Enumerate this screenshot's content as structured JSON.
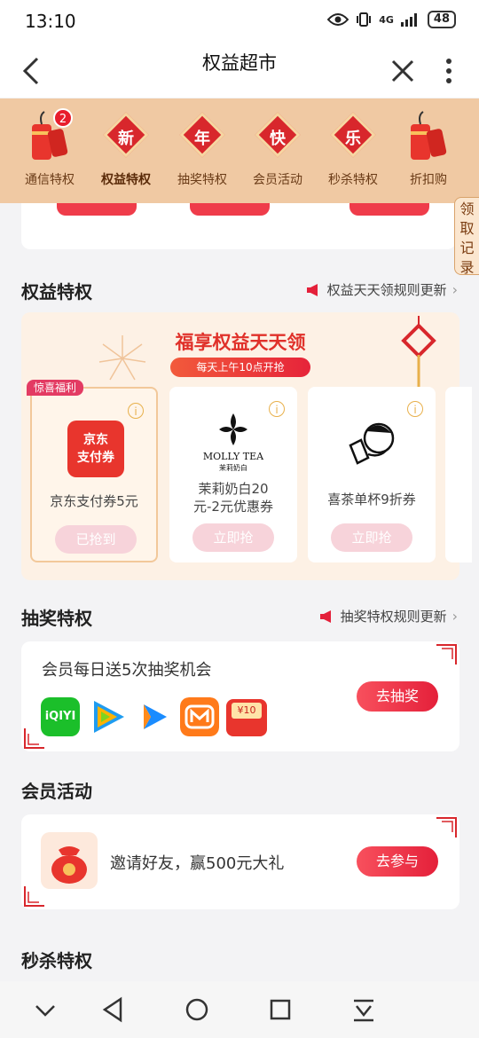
{
  "status": {
    "time": "13:10",
    "network": "4G",
    "battery": "48"
  },
  "header": {
    "title": "权益超市"
  },
  "categories": [
    {
      "label": "通信特权",
      "icon": "firecracker-icon",
      "badge": "2",
      "active": false
    },
    {
      "label": "权益特权",
      "icon_char": "新",
      "active": true
    },
    {
      "label": "抽奖特权",
      "icon_char": "年",
      "active": false
    },
    {
      "label": "会员活动",
      "icon_char": "快",
      "active": false
    },
    {
      "label": "秒杀特权",
      "icon_char": "乐",
      "active": false
    },
    {
      "label": "折扣购",
      "icon": "firecracker-icon",
      "active": false
    }
  ],
  "side_tab": {
    "label": "领取记录"
  },
  "rights_section": {
    "title": "权益特权",
    "rule_text": "权益天天领规则更新",
    "daily_title": "福享权益天天领",
    "daily_pill": "每天上午10点开抢",
    "surprise_tag": "惊喜福利",
    "coupons": [
      {
        "logo_line1": "京东",
        "logo_line2": "支付券",
        "name": "京东支付券5元",
        "button": "已抢到"
      },
      {
        "logo_text": "MOLLY TEA",
        "logo_sub": "茉莉奶白",
        "name_line1": "茉莉奶白20",
        "name_line2": "元-2元优惠券",
        "button": "立即抢"
      },
      {
        "name": "喜茶单杯9折券",
        "button": "立即抢"
      }
    ]
  },
  "lottery_section": {
    "title": "抽奖特权",
    "rule_text": "抽奖特权规则更新",
    "card_text": "会员每日送5次抽奖机会",
    "button": "去抽奖",
    "apps": [
      {
        "name": "iqiyi-icon",
        "label": "iQIYI",
        "color": "#1bbf2a"
      },
      {
        "name": "tencent-video-icon",
        "color": "#1f9cf0"
      },
      {
        "name": "youku-icon",
        "color": "#1a8cff"
      },
      {
        "name": "mango-tv-icon",
        "color": "#ff7a1a"
      },
      {
        "name": "red-packet-icon",
        "label": "¥10",
        "color": "#e8352d"
      }
    ]
  },
  "activity_section": {
    "title": "会员活动",
    "card_text": "邀请好友，赢500元大礼",
    "button": "去参与"
  },
  "flash_section": {
    "title": "秒杀特权"
  },
  "colors": {
    "accent": "#e4203a",
    "strip": "#f0c9a3",
    "panel": "#fdf1e5"
  }
}
